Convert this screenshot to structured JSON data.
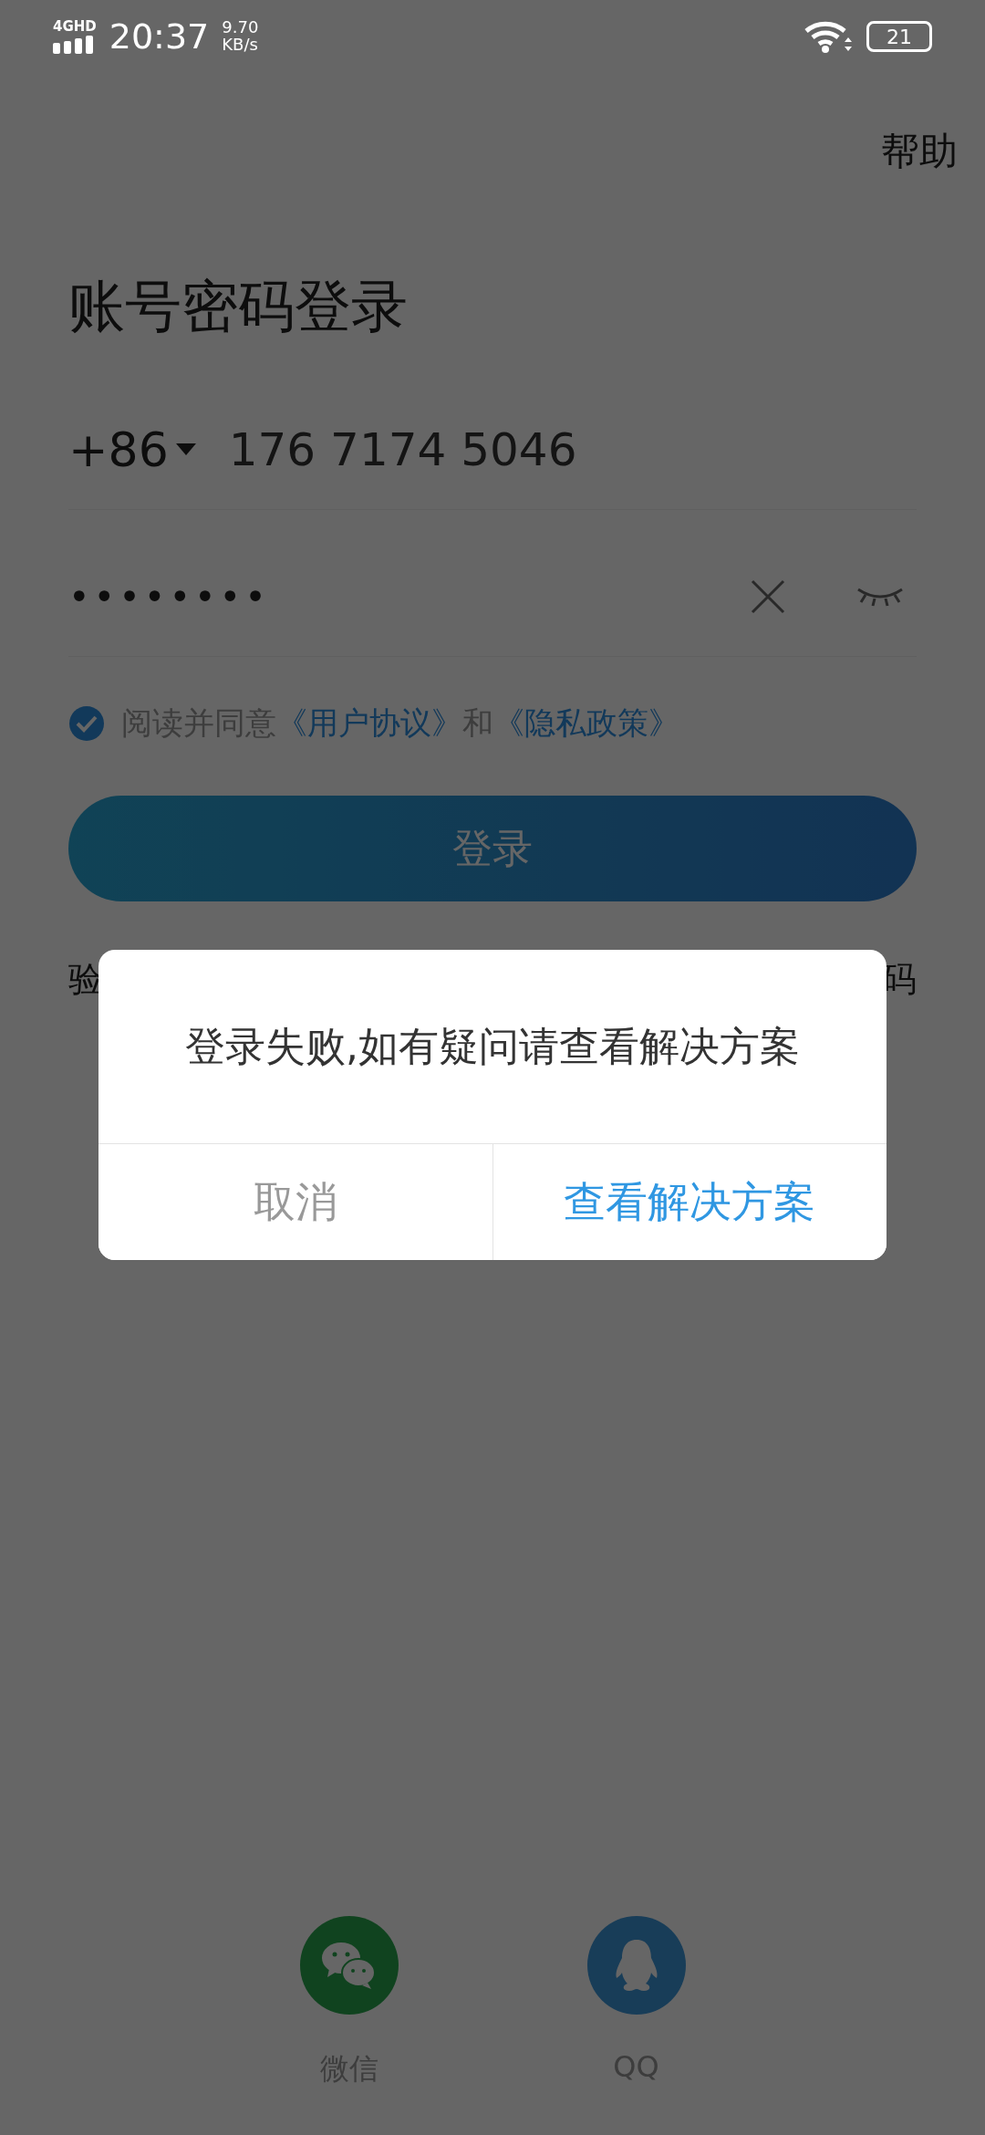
{
  "status_bar": {
    "network": "4GHD",
    "time": "20:37",
    "speed_value": "9.70",
    "speed_unit": "KB/s",
    "battery": "21"
  },
  "help": "帮助",
  "title": "账号密码登录",
  "phone": {
    "country_code": "+86",
    "value": "176 7174 5046"
  },
  "password": {
    "value": "••••••••"
  },
  "agreement": {
    "checked": true,
    "parts": [
      {
        "kind": "plain",
        "text": "阅读并同意"
      },
      {
        "kind": "link",
        "text": "《用户协议》"
      },
      {
        "kind": "plain",
        "text": "和"
      },
      {
        "kind": "link",
        "text": "《隐私政策》"
      }
    ]
  },
  "login_button": "登录",
  "below_left": "验",
  "below_right": "码",
  "dialog": {
    "message": "登录失败,如有疑问请查看解决方案",
    "buttons": [
      {
        "kind": "cancel",
        "label": "取消"
      },
      {
        "kind": "primary",
        "label": "查看解决方案"
      }
    ]
  },
  "social": [
    {
      "kind": "wechat",
      "label": "微信"
    },
    {
      "kind": "qq",
      "label": "QQ"
    }
  ]
}
